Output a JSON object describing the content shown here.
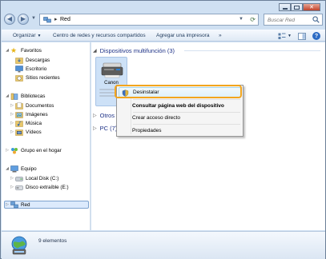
{
  "address": {
    "location": "Red"
  },
  "search": {
    "placeholder": "Buscar Red"
  },
  "toolbar": {
    "organize": "Organizar",
    "network_center": "Centro de redes y recursos compartidos",
    "add_printer": "Agregar una impresora",
    "more": "»"
  },
  "nav": {
    "favorites": "Favoritos",
    "downloads": "Descargas",
    "desktop": "Escritorio",
    "recent": "Sitios recientes",
    "libraries": "Bibliotecas",
    "documents": "Documentos",
    "images": "Imágenes",
    "music": "Música",
    "videos": "Vídeos",
    "homegroup": "Grupo en el hogar",
    "computer": "Equipo",
    "local_disk": "Local Disk (C:)",
    "removable": "Disco extraíble (E:)",
    "network": "Red"
  },
  "groups": {
    "multifunction": "Dispositivos multifunción (3)",
    "other": "Otros",
    "pc": "PC (7)"
  },
  "device": {
    "name": "Canon"
  },
  "context_menu": {
    "uninstall": "Desinstalar",
    "view_web": "Consultar página web del dispositivo",
    "shortcut": "Crear acceso directo",
    "properties": "Propiedades"
  },
  "status": {
    "items": "9 elementos"
  },
  "colors": {
    "accent_callout": "#f3a51d",
    "group_header": "#1e3287",
    "selected_bg": "#dceafc"
  }
}
